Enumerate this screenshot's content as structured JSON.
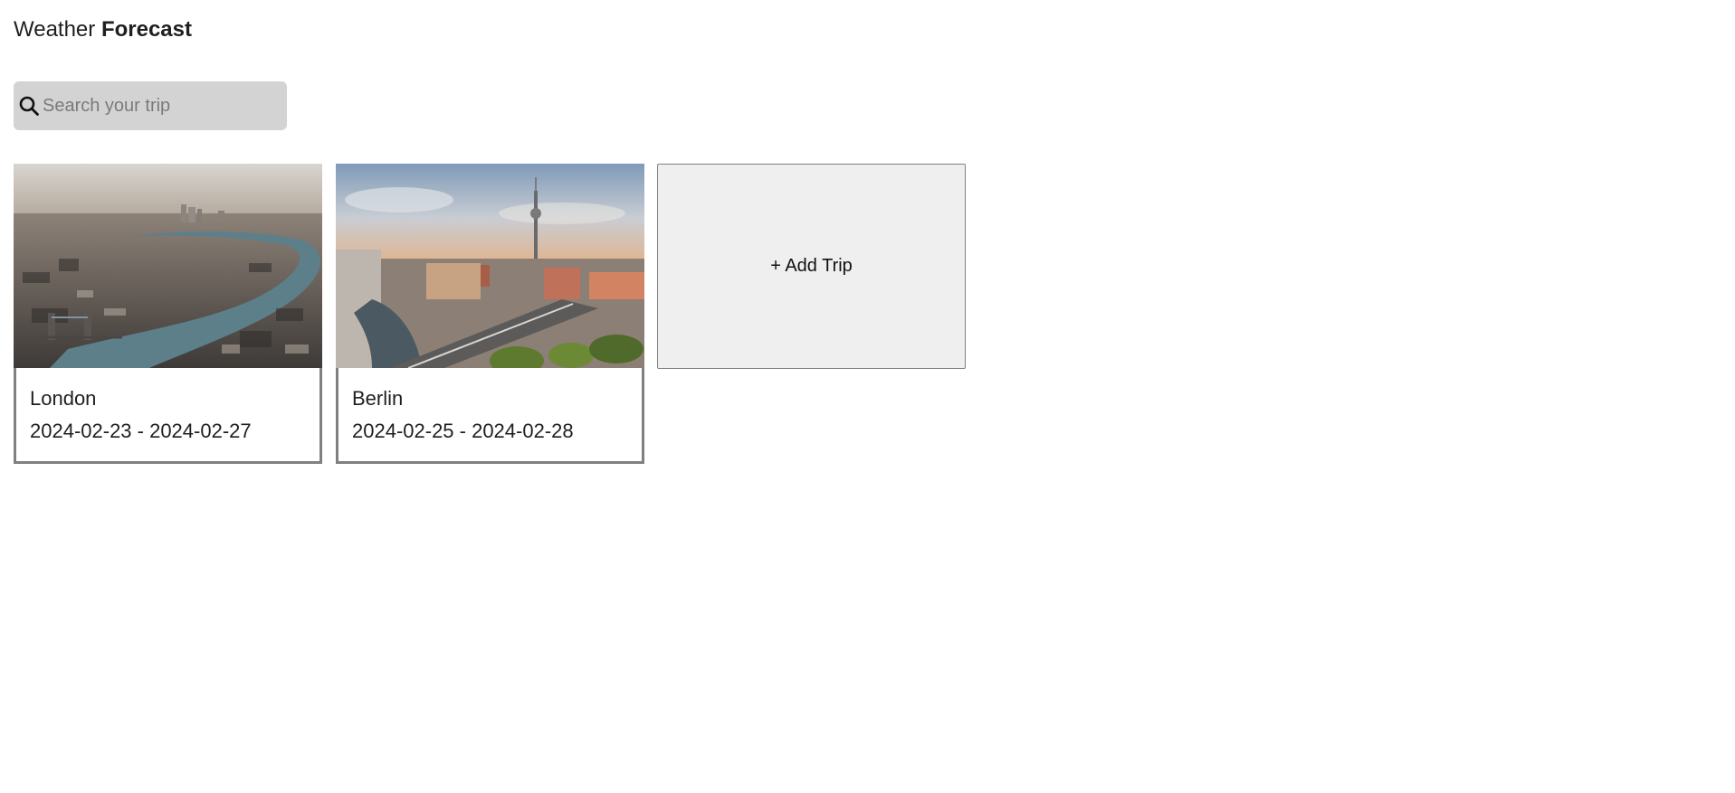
{
  "header": {
    "title_plain": "Weather",
    "title_bold": "Forecast"
  },
  "search": {
    "placeholder": "Search your trip",
    "value": "",
    "icon": "search-icon"
  },
  "trips": [
    {
      "city": "London",
      "dates": "2024-02-23 - 2024-02-27"
    },
    {
      "city": "Berlin",
      "dates": "2024-02-25 - 2024-02-28"
    }
  ],
  "add_trip": {
    "label": "+ Add Trip"
  },
  "colors": {
    "search_bg": "#d3d3d3",
    "card_border": "#808080",
    "add_trip_bg": "#efefef"
  }
}
